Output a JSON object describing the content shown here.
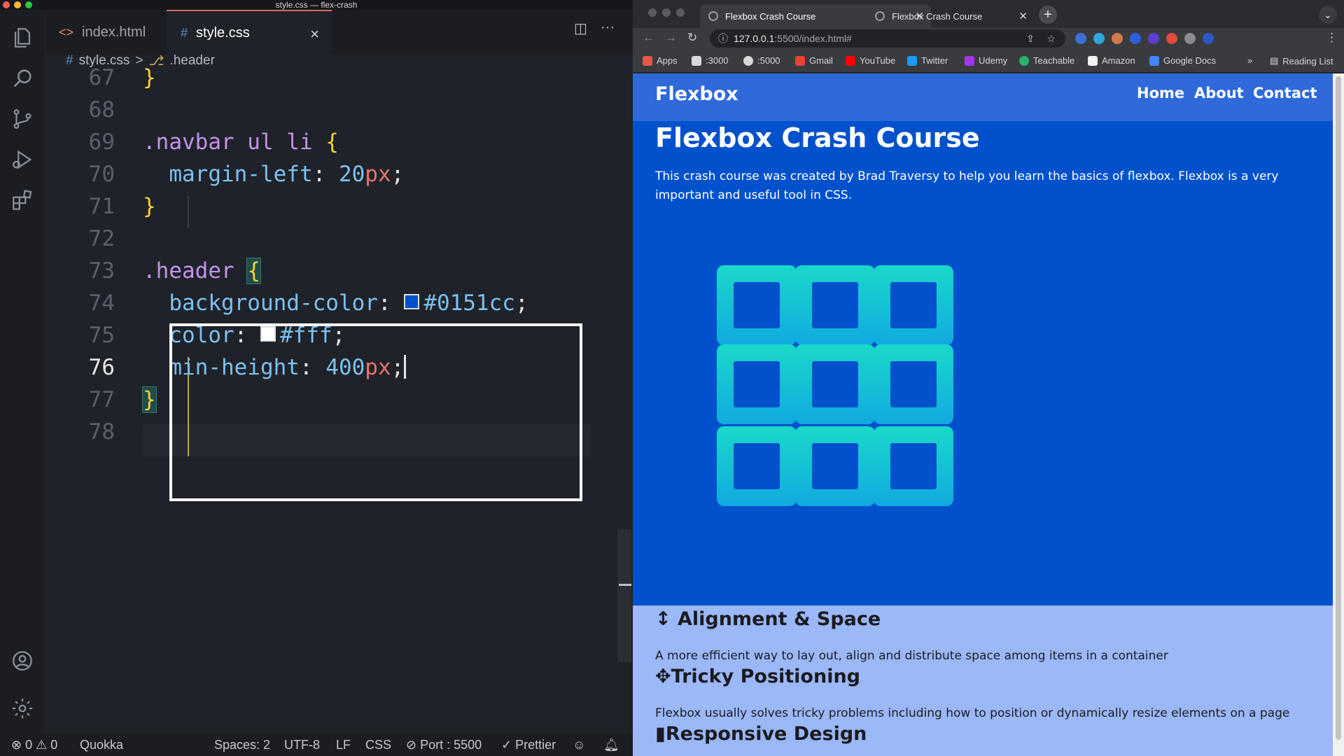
{
  "vscode": {
    "window_title": "style.css — flex-crash",
    "tabs": [
      {
        "label": "index.html",
        "glyph": "<>"
      },
      {
        "label": "style.css",
        "glyph": "#"
      }
    ],
    "tab_close_glyph": "×",
    "split_glyph": "◫",
    "more_glyph": "···",
    "breadcrumb": {
      "file": "style.css",
      "separator": ">",
      "symbol": ".header",
      "file_glyph": "#",
      "symbol_glyph": "⎇"
    },
    "editor": {
      "current_line": "76",
      "lines": [
        {
          "n": "67",
          "parts": [
            {
              "t": "}",
              "c": "c-brace"
            }
          ]
        },
        {
          "n": "68",
          "parts": []
        },
        {
          "n": "69",
          "parts": [
            {
              "t": ".navbar ul li ",
              "c": "c-sel"
            },
            {
              "t": "{",
              "c": "c-brace"
            }
          ]
        },
        {
          "n": "70",
          "parts": [
            {
              "t": "  margin-left",
              "c": "c-prop"
            },
            {
              "t": ": ",
              "c": "c-punc"
            },
            {
              "t": "20",
              "c": "c-num"
            },
            {
              "t": "px",
              "c": "c-val"
            },
            {
              "t": ";",
              "c": "c-punc"
            }
          ]
        },
        {
          "n": "71",
          "parts": [
            {
              "t": "}",
              "c": "c-brace"
            }
          ]
        },
        {
          "n": "72",
          "parts": []
        },
        {
          "n": "73",
          "parts": [
            {
              "t": ".header ",
              "c": "c-sel"
            },
            {
              "t": "{",
              "c": "c-brace",
              "hl": true
            }
          ]
        },
        {
          "n": "74",
          "parts": [
            {
              "t": "  background-color",
              "c": "c-prop"
            },
            {
              "t": ": ",
              "c": "c-punc"
            },
            {
              "swatch": "#0151cc"
            },
            {
              "t": "#0151cc",
              "c": "c-color"
            },
            {
              "t": ";",
              "c": "c-punc"
            }
          ]
        },
        {
          "n": "75",
          "parts": [
            {
              "t": "  color",
              "c": "c-prop"
            },
            {
              "t": ": ",
              "c": "c-punc"
            },
            {
              "swatch": "#ffffff"
            },
            {
              "t": "#fff",
              "c": "c-color"
            },
            {
              "t": ";",
              "c": "c-punc"
            }
          ]
        },
        {
          "n": "76",
          "parts": [
            {
              "t": "  min-height",
              "c": "c-prop"
            },
            {
              "t": ": ",
              "c": "c-punc"
            },
            {
              "t": "400",
              "c": "c-num"
            },
            {
              "t": "px",
              "c": "c-val"
            },
            {
              "t": ";",
              "c": "c-punc"
            },
            {
              "cursor": true
            }
          ]
        },
        {
          "n": "77",
          "parts": [
            {
              "t": "}",
              "c": "c-brace",
              "hl": true
            }
          ]
        },
        {
          "n": "78",
          "parts": []
        }
      ]
    },
    "status": {
      "errors": "0",
      "warnings": "0",
      "extension": "Quokka",
      "spaces": "Spaces: 2",
      "encoding": "UTF-8",
      "eol": "LF",
      "language": "CSS",
      "port": "Port : 5500",
      "prettier": "Prettier"
    }
  },
  "browser": {
    "tabs": [
      {
        "title": "Flexbox Crash Course",
        "active": true
      },
      {
        "title": "Flexbox Crash Course",
        "active": false
      }
    ],
    "new_tab_glyph": "+",
    "address_host": "127.0.0.1",
    "address_rest": ":5500/index.html#",
    "bookmarks": [
      {
        "label": "Apps",
        "color": "#e05a47"
      },
      {
        "label": ":3000",
        "color": "#d8d8d8"
      },
      {
        "label": ":5000",
        "color": "#d8d8d8"
      },
      {
        "label": "Gmail",
        "color": "#ea4335"
      },
      {
        "label": "YouTube",
        "color": "#ff0000"
      },
      {
        "label": "Twitter",
        "color": "#1d9bf0"
      },
      {
        "label": "Udemy",
        "color": "#a435f0"
      },
      {
        "label": "Teachable",
        "color": "#29b36b"
      },
      {
        "label": "Amazon",
        "color": "#f2f2f2"
      },
      {
        "label": "Google Docs",
        "color": "#4285f4"
      }
    ],
    "bookmarks_overflow": "»",
    "reading_list": "Reading List",
    "page": {
      "logo": "Flexbox",
      "nav": [
        "Home",
        "About",
        "Contact"
      ],
      "hero_title": "Flexbox Crash Course",
      "hero_text": "This crash course was created by Brad Traversy to help you learn the basics of flexbox. Flexbox is a very important and useful tool in CSS.",
      "features": [
        {
          "icon": "↕",
          "title": "Alignment & Space",
          "text": "A more efficient way to lay out, align and distribute space among items in a container"
        },
        {
          "icon": "✥",
          "title": "Tricky Positioning",
          "text": "Flexbox usually solves tricky problems including how to position or dynamically resize elements on a page"
        },
        {
          "icon": "▮",
          "title": "Responsive Design",
          "text": ""
        }
      ],
      "colors": {
        "header_bg": "#0151cc",
        "navbar_bg": "#2f69da",
        "features_bg": "#9bb8f8",
        "grid_top": "#19d9c9",
        "grid_bottom": "#11a9e0"
      }
    }
  }
}
